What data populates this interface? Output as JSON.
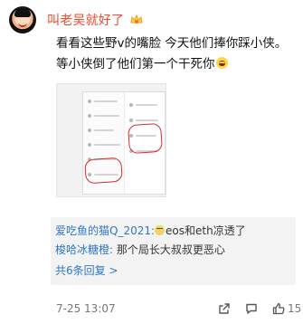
{
  "post": {
    "author": "叫老吴就好了",
    "content_line_1": "看看这些野v的嘴脸 今天他们捧你踩小侠。",
    "content_line_2": "等小侠倒了他们第一个干死你",
    "timestamp": "7-25 13:07",
    "like_count": "15"
  },
  "comments": {
    "items": [
      {
        "user": "爱吃鱼的猫Q_2021:",
        "text": "eos和eth凉透了"
      },
      {
        "user": "梭哈冰糖橙:",
        "text": " 那个局长大叔叔更恶心"
      }
    ],
    "more_replies": "共6条回复 >"
  },
  "icons": {
    "badge": "crown-badge-icon",
    "content_emoji": "laughing-emoji-icon",
    "comment_emoji": "smiling-emoji-icon",
    "share": "share-icon",
    "comment": "comment-icon",
    "like": "thumbs-up-icon"
  },
  "colors": {
    "username": "#f04a2a",
    "comment_username": "#2f78c4",
    "reply_link": "#2f78c4",
    "comment_background": "#f3f3f3",
    "footer_text": "#777777"
  }
}
